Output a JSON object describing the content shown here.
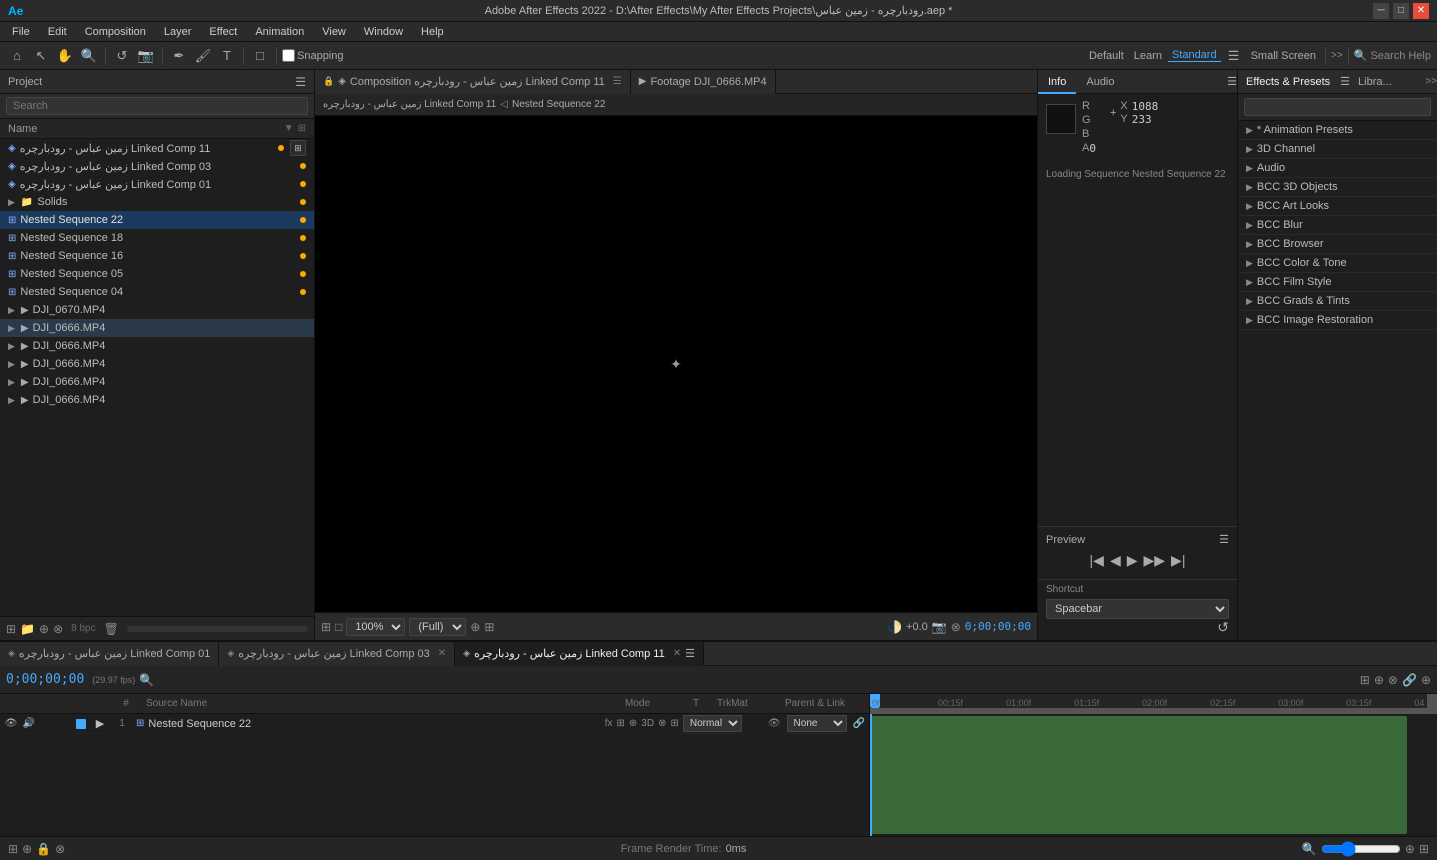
{
  "titlebar": {
    "title": "Adobe After Effects 2022 - D:\\After Effects\\My After Effects Projects\\رودبارچره - زمین عباس.aep *",
    "appname": "Ae"
  },
  "menubar": {
    "items": [
      "File",
      "Edit",
      "Composition",
      "Layer",
      "Effect",
      "Animation",
      "View",
      "Window",
      "Help"
    ]
  },
  "toolbar": {
    "snapping_label": "Snapping",
    "workspace_options": [
      "Default",
      "Learn",
      "Standard",
      "Small Screen"
    ]
  },
  "project": {
    "panel_label": "Project",
    "search_placeholder": "Search",
    "columns": {
      "name": "Name"
    },
    "items": [
      {
        "name": "زمین عباس - رودبارچره Linked Comp 11",
        "type": "comp",
        "dot": "yellow"
      },
      {
        "name": "زمین عباس - رودبارچره Linked Comp 03",
        "type": "comp",
        "dot": "yellow"
      },
      {
        "name": "زمین عباس - رودبارچره Linked Comp 01",
        "type": "comp",
        "dot": "yellow"
      },
      {
        "name": "Solids",
        "type": "folder",
        "dot": "yellow"
      },
      {
        "name": "Nested Sequence 22",
        "type": "nested",
        "dot": "yellow",
        "selected": true
      },
      {
        "name": "Nested Sequence 18",
        "type": "nested",
        "dot": "yellow"
      },
      {
        "name": "Nested Sequence 16",
        "type": "nested",
        "dot": "yellow"
      },
      {
        "name": "Nested Sequence 05",
        "type": "nested",
        "dot": "yellow"
      },
      {
        "name": "Nested Sequence 04",
        "type": "nested",
        "dot": "yellow"
      },
      {
        "name": "DJI_0670.MP4",
        "type": "footage",
        "dot": "none"
      },
      {
        "name": "DJI_0666.MP4",
        "type": "footage",
        "dot": "none",
        "highlighted": true
      },
      {
        "name": "DJI_0666.MP4",
        "type": "footage",
        "dot": "none"
      },
      {
        "name": "DJI_0666.MP4",
        "type": "footage",
        "dot": "none"
      },
      {
        "name": "DJI_0666.MP4",
        "type": "footage",
        "dot": "none"
      },
      {
        "name": "DJI_0666.MP4",
        "type": "footage",
        "dot": "none"
      }
    ]
  },
  "viewer": {
    "tabs": [
      {
        "label": "Composition زمین عباس - رودبارچره Linked Comp 11",
        "active": false,
        "locked": false,
        "closeable": true
      },
      {
        "label": "Footage  DJI_0666.MP4",
        "active": false,
        "locked": false,
        "closeable": false
      }
    ],
    "breadcrumb": [
      "زمین عباس - رودبارچره Linked Comp 11",
      "Nested Sequence 22"
    ],
    "zoom": "100%",
    "quality": "(Full)",
    "timecode": "0;00;00;00",
    "time_value": "0;00;00;00"
  },
  "info_panel": {
    "tabs": [
      "Info",
      "Audio"
    ],
    "active_tab": "Info",
    "R": "R",
    "G": "G",
    "B": "B",
    "A": "A",
    "R_val": "",
    "G_val": "",
    "B_val": "",
    "A_val": "0",
    "X_label": "X",
    "Y_label": "Y",
    "X_val": "1088",
    "Y_val": "233",
    "status": "Loading Sequence Nested Sequence 22"
  },
  "preview_panel": {
    "label": "Preview",
    "shortcut_label": "Shortcut",
    "shortcut_options": [
      "Spacebar"
    ]
  },
  "effects_panel": {
    "tabs": [
      "Effects & Presets",
      "Librar"
    ],
    "active_tab": "Effects & Presets",
    "search_placeholder": "",
    "categories": [
      {
        "name": "* Animation Presets",
        "expanded": false
      },
      {
        "name": "3D Channel",
        "expanded": false
      },
      {
        "name": "Audio",
        "expanded": false
      },
      {
        "name": "BCC 3D Objects",
        "expanded": false
      },
      {
        "name": "BCC Art Looks",
        "expanded": false
      },
      {
        "name": "BCC Blur",
        "expanded": false
      },
      {
        "name": "BCC Browser",
        "expanded": false
      },
      {
        "name": "BCC Color & Tone",
        "expanded": false
      },
      {
        "name": "BCC Film Style",
        "expanded": false
      },
      {
        "name": "BCC Grads & Tints",
        "expanded": false
      },
      {
        "name": "BCC Image Restoration",
        "expanded": false
      }
    ]
  },
  "timeline": {
    "tabs": [
      {
        "label": "زمین عباس - رودبارچره Linked Comp 01",
        "active": false,
        "closeable": false
      },
      {
        "label": "زمین عباس - رودبارچره Linked Comp 03",
        "active": false,
        "closeable": true
      },
      {
        "label": "زمین عباس - رودبارچره Linked Comp 11",
        "active": true,
        "closeable": true
      }
    ],
    "timecode": "0;00;00;00",
    "fps": "(29.97 fps)",
    "search_placeholder": "",
    "columns": [
      "",
      "",
      "",
      "#",
      "Source Name",
      "",
      "Mode",
      "T",
      "TrkMat",
      "Parent & Link"
    ],
    "layers": [
      {
        "num": 1,
        "visible": true,
        "icon": "nested",
        "name": "Nested Sequence 22",
        "mode": "Normal",
        "trk_mat": "",
        "parent": "None"
      }
    ],
    "ruler": {
      "labels": [
        "0f",
        "00;15f",
        "01;00f",
        "01;15f",
        "02;00f",
        "02;15f",
        "03;00f",
        "03;15f",
        "04"
      ],
      "work_area_start": 0,
      "work_area_end": 100
    },
    "footer": {
      "render_time_label": "Frame Render Time:",
      "render_time_val": "0ms"
    }
  }
}
